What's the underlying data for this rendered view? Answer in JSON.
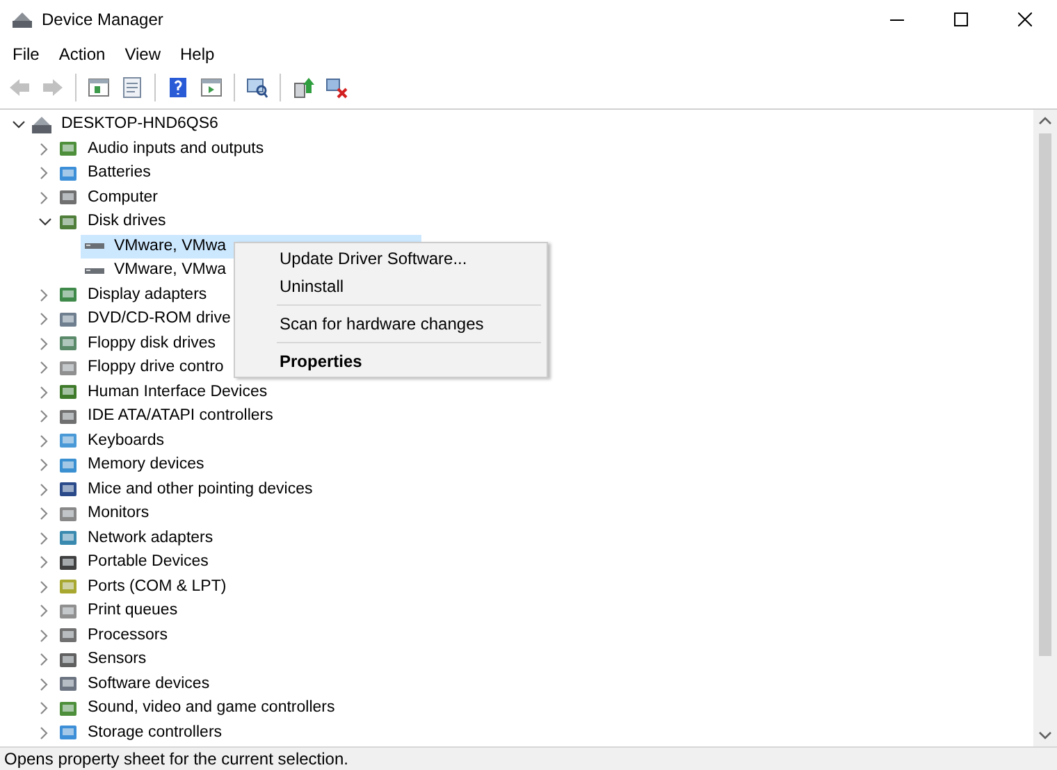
{
  "window": {
    "title": "Device Manager"
  },
  "menu_bar": [
    "File",
    "Action",
    "View",
    "Help"
  ],
  "toolbar": [
    {
      "kind": "back",
      "disabled": true
    },
    {
      "kind": "forward",
      "disabled": true
    },
    {
      "kind": "separator"
    },
    {
      "kind": "console",
      "disabled": false
    },
    {
      "kind": "properties",
      "disabled": false
    },
    {
      "kind": "separator"
    },
    {
      "kind": "help",
      "disabled": false
    },
    {
      "kind": "action",
      "disabled": false
    },
    {
      "kind": "separator"
    },
    {
      "kind": "scan",
      "disabled": false
    },
    {
      "kind": "separator"
    },
    {
      "kind": "update",
      "disabled": false
    },
    {
      "kind": "uninstall",
      "disabled": false
    }
  ],
  "tree": [
    {
      "label": "DESKTOP-HND6QS6",
      "expanded": true,
      "selected": false,
      "children": [
        {
          "label": "Audio inputs and outputs",
          "expanded": false,
          "selected": false
        },
        {
          "label": "Batteries",
          "expanded": false,
          "selected": false
        },
        {
          "label": "Computer",
          "expanded": false,
          "selected": false
        },
        {
          "label": "Disk drives",
          "expanded": true,
          "selected": false,
          "children": [
            {
              "label": "VMware, VMwa",
              "selected": true
            },
            {
              "label": "VMware, VMwa",
              "selected": false
            }
          ]
        },
        {
          "label": "Display adapters",
          "expanded": false,
          "selected": false
        },
        {
          "label": "DVD/CD-ROM drive",
          "expanded": false,
          "selected": false
        },
        {
          "label": "Floppy disk drives",
          "expanded": false,
          "selected": false
        },
        {
          "label": "Floppy drive contro",
          "expanded": false,
          "selected": false
        },
        {
          "label": "Human Interface Devices",
          "expanded": false,
          "selected": false
        },
        {
          "label": "IDE ATA/ATAPI controllers",
          "expanded": false,
          "selected": false
        },
        {
          "label": "Keyboards",
          "expanded": false,
          "selected": false
        },
        {
          "label": "Memory devices",
          "expanded": false,
          "selected": false
        },
        {
          "label": "Mice and other pointing devices",
          "expanded": false,
          "selected": false
        },
        {
          "label": "Monitors",
          "expanded": false,
          "selected": false
        },
        {
          "label": "Network adapters",
          "expanded": false,
          "selected": false
        },
        {
          "label": "Portable Devices",
          "expanded": false,
          "selected": false
        },
        {
          "label": "Ports (COM & LPT)",
          "expanded": false,
          "selected": false
        },
        {
          "label": "Print queues",
          "expanded": false,
          "selected": false
        },
        {
          "label": "Processors",
          "expanded": false,
          "selected": false
        },
        {
          "label": "Sensors",
          "expanded": false,
          "selected": false
        },
        {
          "label": "Software devices",
          "expanded": false,
          "selected": false
        },
        {
          "label": "Sound, video and game controllers",
          "expanded": false,
          "selected": false
        },
        {
          "label": "Storage controllers",
          "expanded": false,
          "selected": false
        }
      ]
    }
  ],
  "context_menu": [
    {
      "kind": "item",
      "label": "Update Driver Software...",
      "default": false
    },
    {
      "kind": "item",
      "label": "Uninstall",
      "default": false
    },
    {
      "kind": "separator"
    },
    {
      "kind": "item",
      "label": "Scan for hardware changes",
      "default": false
    },
    {
      "kind": "separator"
    },
    {
      "kind": "item",
      "label": "Properties",
      "default": true
    }
  ],
  "status_bar": "Opens property sheet for the current selection."
}
